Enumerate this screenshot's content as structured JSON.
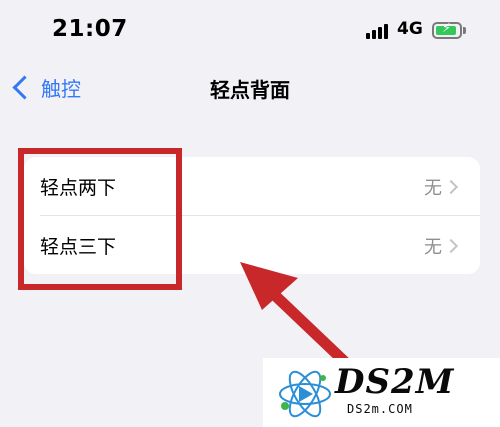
{
  "status_bar": {
    "time": "21:07",
    "network": "4G",
    "battery_level": 0.9,
    "battery_color": "#34c759"
  },
  "nav": {
    "back_label": "触控",
    "title": "轻点背面",
    "back_icon": "chevron-left-icon",
    "accent": "#3478f6"
  },
  "settings": {
    "rows": [
      {
        "label": "轻点两下",
        "value": "无"
      },
      {
        "label": "轻点三下",
        "value": "无"
      }
    ]
  },
  "annotation": {
    "color": "#c8282a"
  },
  "watermark": {
    "brand": "DS2M",
    "site": "DS2m.COM"
  }
}
